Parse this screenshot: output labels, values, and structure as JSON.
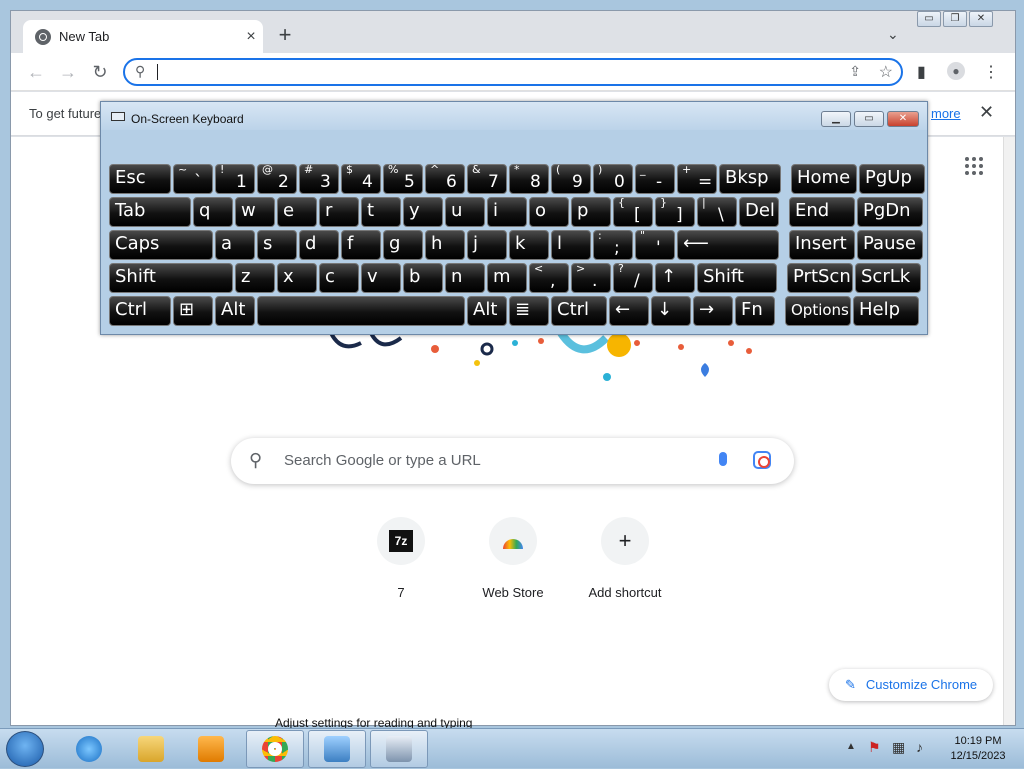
{
  "browser": {
    "tab_title": "New Tab",
    "tab_close": "×",
    "new_tab": "+",
    "tab_menu": "⌄",
    "window_buttons": [
      "▭",
      "❐",
      "✕"
    ],
    "omnibox_value": "",
    "infobar_message": "To get future",
    "infobar_link": "more",
    "infobar_close": "✕"
  },
  "newtab": {
    "search_placeholder": "Search Google or type a URL",
    "shortcuts": [
      {
        "label": "7",
        "icon": "7z"
      },
      {
        "label": "Web Store",
        "icon": "web-store-icon"
      },
      {
        "label": "Add shortcut",
        "icon": "+"
      }
    ],
    "customize_label": "Customize Chrome",
    "customize_icon": "✎"
  },
  "osk": {
    "title": "On-Screen Keyboard",
    "rows": [
      [
        {
          "t": "Esc"
        },
        {
          "s": "~",
          "m": "`"
        },
        {
          "s": "!",
          "m": "1"
        },
        {
          "s": "@",
          "m": "2"
        },
        {
          "s": "#",
          "m": "3"
        },
        {
          "s": "$",
          "m": "4"
        },
        {
          "s": "%",
          "m": "5"
        },
        {
          "s": "^",
          "m": "6"
        },
        {
          "s": "&",
          "m": "7"
        },
        {
          "s": "*",
          "m": "8"
        },
        {
          "s": "(",
          "m": "9"
        },
        {
          "s": ")",
          "m": "0"
        },
        {
          "s": "_",
          "m": "-"
        },
        {
          "s": "+",
          "m": "="
        },
        {
          "t": "Bksp"
        },
        {
          "t": "Home"
        },
        {
          "t": "PgUp"
        }
      ],
      [
        {
          "t": "Tab"
        },
        {
          "t": "q"
        },
        {
          "t": "w"
        },
        {
          "t": "e"
        },
        {
          "t": "r"
        },
        {
          "t": "t"
        },
        {
          "t": "y"
        },
        {
          "t": "u"
        },
        {
          "t": "i"
        },
        {
          "t": "o"
        },
        {
          "t": "p"
        },
        {
          "s": "{",
          "m": "["
        },
        {
          "s": "}",
          "m": "]"
        },
        {
          "s": "|",
          "m": "\\"
        },
        {
          "t": "Del"
        },
        {
          "t": "End"
        },
        {
          "t": "PgDn"
        }
      ],
      [
        {
          "t": "Caps"
        },
        {
          "t": "a"
        },
        {
          "t": "s"
        },
        {
          "t": "d"
        },
        {
          "t": "f"
        },
        {
          "t": "g"
        },
        {
          "t": "h"
        },
        {
          "t": "j"
        },
        {
          "t": "k"
        },
        {
          "t": "l"
        },
        {
          "s": ":",
          "m": ";"
        },
        {
          "s": "\"",
          "m": "'"
        },
        {
          "t": "⟵"
        },
        {
          "t": "Insert"
        },
        {
          "t": "Pause"
        }
      ],
      [
        {
          "t": "Shift"
        },
        {
          "t": "z"
        },
        {
          "t": "x"
        },
        {
          "t": "c"
        },
        {
          "t": "v"
        },
        {
          "t": "b"
        },
        {
          "t": "n"
        },
        {
          "t": "m"
        },
        {
          "s": "<",
          "m": ","
        },
        {
          "s": ">",
          "m": "."
        },
        {
          "s": "?",
          "m": "/"
        },
        {
          "t": "↑"
        },
        {
          "t": "Shift"
        },
        {
          "t": "PrtScn"
        },
        {
          "t": "ScrLk"
        }
      ],
      [
        {
          "t": "Ctrl"
        },
        {
          "t": "⊞"
        },
        {
          "t": "Alt"
        },
        {
          "t": ""
        },
        {
          "t": "Alt"
        },
        {
          "t": "≣"
        },
        {
          "t": "Ctrl"
        },
        {
          "t": "←"
        },
        {
          "t": "↓"
        },
        {
          "t": "→"
        },
        {
          "t": "Fn"
        },
        {
          "t": "Options"
        },
        {
          "t": "Help"
        }
      ]
    ]
  },
  "taskbar": {
    "tooltip": "Adjust settings for reading and typing",
    "time": "10:19 PM",
    "date": "12/15/2023"
  }
}
